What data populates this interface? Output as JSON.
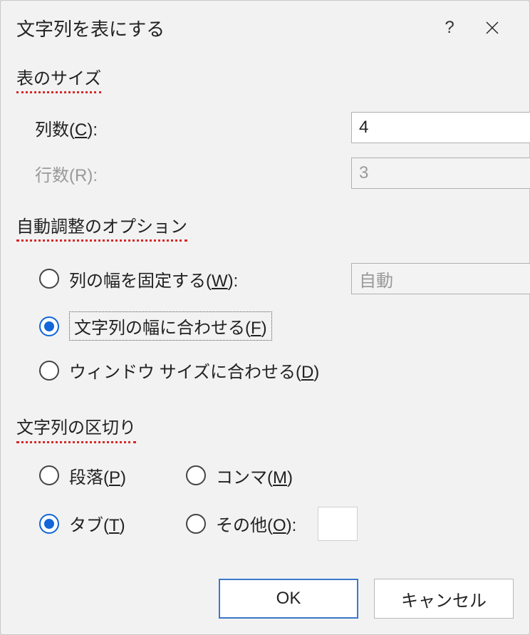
{
  "dialog": {
    "title": "文字列を表にする",
    "help": "?"
  },
  "size": {
    "heading": "表のサイズ",
    "cols_label_pre": "列数(",
    "cols_accel": "C",
    "cols_label_post": "):",
    "cols_value": "4",
    "rows_label_pre": "行数(",
    "rows_accel": "R",
    "rows_label_post": "):",
    "rows_value": "3"
  },
  "autofit": {
    "heading": "自動調整のオプション",
    "fixed": {
      "pre": "列の幅を固定する(",
      "accel": "W",
      "post": "):"
    },
    "fit_contents": {
      "pre": "文字列の幅に合わせる(",
      "accel": "F",
      "post": ")"
    },
    "fit_window": {
      "pre": "ウィンドウ サイズに合わせる(",
      "accel": "D",
      "post": ")"
    },
    "fixed_spin_value": "自動"
  },
  "sep": {
    "heading": "文字列の区切り",
    "para": {
      "pre": "段落(",
      "accel": "P",
      "post": ")"
    },
    "comma": {
      "pre": "コンマ(",
      "accel": "M",
      "post": ")"
    },
    "tab": {
      "pre": "タブ(",
      "accel": "T",
      "post": ")"
    },
    "other": {
      "pre": "その他(",
      "accel": "O",
      "post": "):"
    },
    "other_value": ""
  },
  "buttons": {
    "ok": "OK",
    "cancel": "キャンセル"
  }
}
